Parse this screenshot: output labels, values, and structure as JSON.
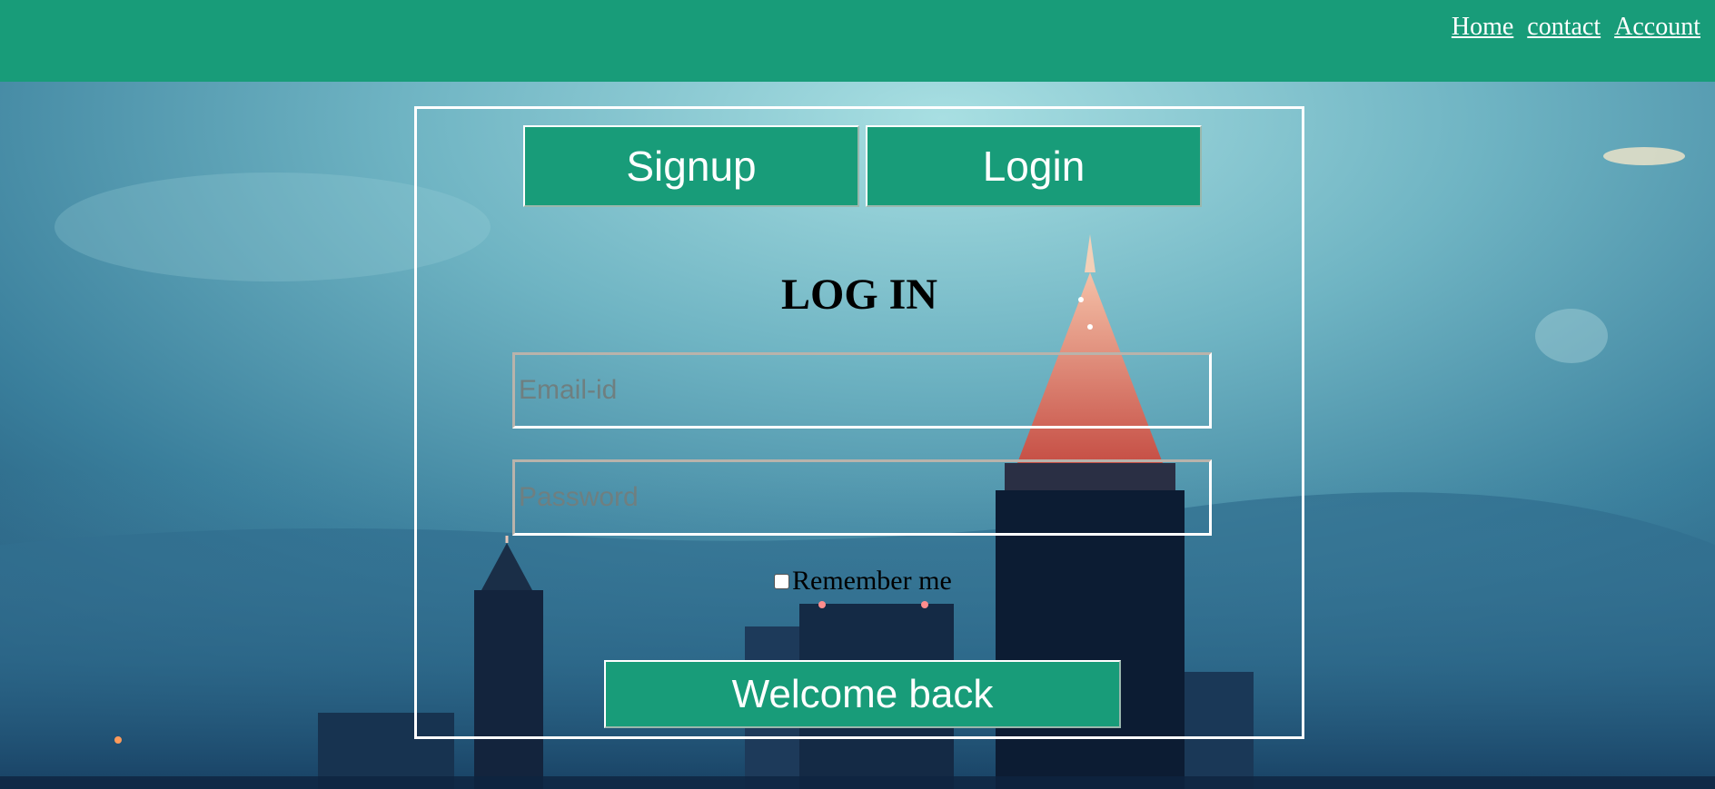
{
  "nav": {
    "links": [
      {
        "label": "Home"
      },
      {
        "label": "contact"
      },
      {
        "label": "Account"
      }
    ]
  },
  "tabs": {
    "signup_label": "Signup",
    "login_label": "Login"
  },
  "form": {
    "title": "LOG IN",
    "email": {
      "placeholder": "Email-id",
      "value": ""
    },
    "password": {
      "placeholder": "Password",
      "value": ""
    },
    "remember_label": "Remember me",
    "remember_checked": false,
    "submit_label": "Welcome back"
  },
  "colors": {
    "accent": "#189c79",
    "border": "#ffffff",
    "text_dark": "#000000",
    "sky_top": "#8fd0d6",
    "city_dark": "#0c1c33"
  },
  "icons": {
    "background": "city-skyline-background"
  }
}
